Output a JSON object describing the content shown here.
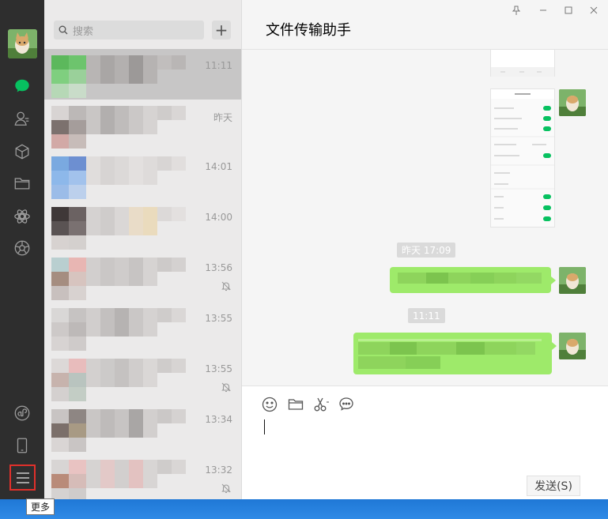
{
  "window": {
    "title": "文件传输助手"
  },
  "sidebar": {
    "tooltip": "更多",
    "icons": [
      "chat-icon",
      "contacts-icon",
      "favorites-icon",
      "files-icon",
      "moments-icon",
      "channels-icon",
      "mini-program-icon",
      "phone-icon",
      "menu-icon"
    ]
  },
  "search": {
    "placeholder": "搜索",
    "add_label": "+"
  },
  "conversations": [
    {
      "time": "11:11",
      "muted": false,
      "selected": true
    },
    {
      "time": "昨天",
      "muted": false,
      "selected": false
    },
    {
      "time": "14:01",
      "muted": false,
      "selected": false
    },
    {
      "time": "14:00",
      "muted": false,
      "selected": false
    },
    {
      "time": "13:56",
      "muted": true,
      "selected": false
    },
    {
      "time": "13:55",
      "muted": false,
      "selected": false
    },
    {
      "time": "13:55",
      "muted": true,
      "selected": false
    },
    {
      "time": "13:34",
      "muted": false,
      "selected": false
    },
    {
      "time": "13:32",
      "muted": true,
      "selected": false
    }
  ],
  "messages": {
    "time_chip_1": "昨天 17:09",
    "time_chip_2": "11:11"
  },
  "composer": {
    "send_label": "发送(S)"
  },
  "colors": {
    "bubble": "#9eea6a",
    "accent": "#07c160",
    "rail": "#2e2e2e"
  }
}
